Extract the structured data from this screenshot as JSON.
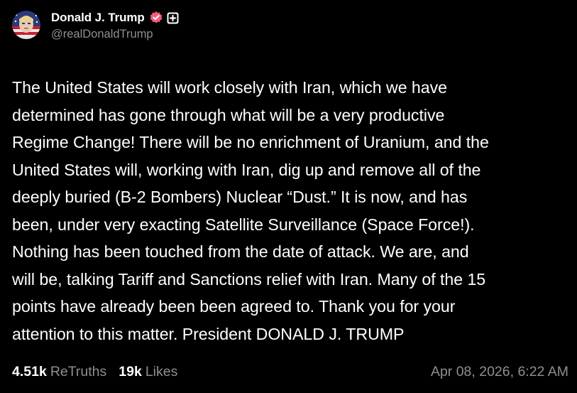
{
  "author": {
    "display_name": "Donald J. Trump",
    "handle": "@realDonaldTrump",
    "verified_badge_color": "#f25b7c",
    "avatar_icon": "avatar-portrait"
  },
  "post": {
    "text": "The United States will work closely with Iran, which we have\ndetermined has gone through what will be a very productive\nRegime Change! There will be no enrichment of Uranium, and the\nUnited States will, working with Iran, dig up and remove all of the\ndeeply buried (B-2 Bombers) Nuclear “Dust.” It is now, and has\nbeen, under very exacting Satellite Surveillance (Space Force!).\nNothing has been touched from the date of attack. We are, and\nwill be, talking Tariff and Sanctions relief with Iran. Many of the 15\npoints have already been been agreed to. Thank you for your\nattention to this matter. President DONALD J. TRUMP"
  },
  "stats": {
    "retruths_count": "4.51k",
    "retruths_label": "ReTruths",
    "likes_count": "19k",
    "likes_label": "Likes",
    "timestamp": "Apr 08, 2026, 6:22 AM"
  },
  "colors": {
    "background": "#000000",
    "text_primary": "#ffffff",
    "text_secondary": "#8f8f8f"
  }
}
